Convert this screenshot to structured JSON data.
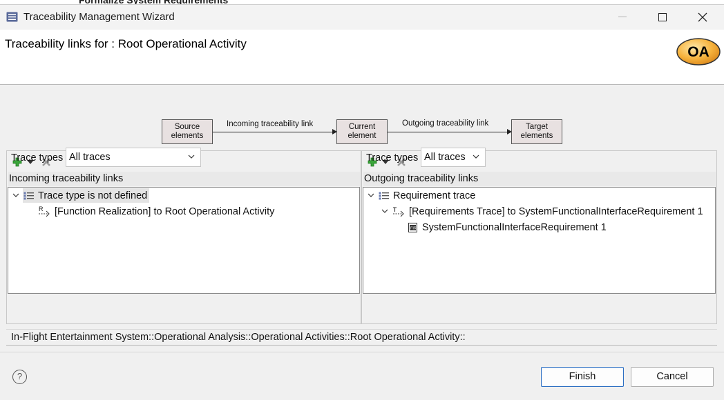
{
  "background_window": {
    "title_fragment": "Formalize System Requirements"
  },
  "window": {
    "title": "Traceability Management Wizard"
  },
  "header": {
    "heading": "Traceability links for : Root Operational Activity",
    "logo_text": "OA"
  },
  "diagram": {
    "source": [
      "Source",
      "elements"
    ],
    "incoming_link": "Incoming traceability link",
    "current": [
      "Current",
      "element"
    ],
    "outgoing_link": "Outgoing traceability link",
    "target": [
      "Target",
      "elements"
    ]
  },
  "incoming": {
    "title": "Incoming traceability links",
    "tree": [
      {
        "label": "Trace type is not defined",
        "icon": "trace-type-icon",
        "expanded": true,
        "selected": true
      },
      {
        "label": "[Function Realization] to Root Operational Activity",
        "icon": "realization-link-icon"
      }
    ],
    "trace_types_label": "Trace types",
    "trace_types_value": "All traces"
  },
  "outgoing": {
    "title": "Outgoing traceability links",
    "tree": [
      {
        "label": "Requirement trace",
        "icon": "trace-type-icon",
        "expanded": true
      },
      {
        "label": "[Requirements Trace] to SystemFunctionalInterfaceRequirement 1",
        "icon": "requirement-trace-link-icon",
        "expanded": true
      },
      {
        "label": "SystemFunctionalInterfaceRequirement 1",
        "icon": "requirement-icon"
      }
    ],
    "trace_types_label": "Trace types",
    "trace_types_value": "All traces"
  },
  "path": "In-Flight Entertainment System::Operational Analysis::Operational Activities::Root Operational Activity::",
  "buttons": {
    "finish": "Finish",
    "cancel": "Cancel",
    "help": "?"
  },
  "colors": {
    "logo_fill": "#f6b23c",
    "add_green": "#3aa53a",
    "finish_border": "#2d6fc2"
  }
}
